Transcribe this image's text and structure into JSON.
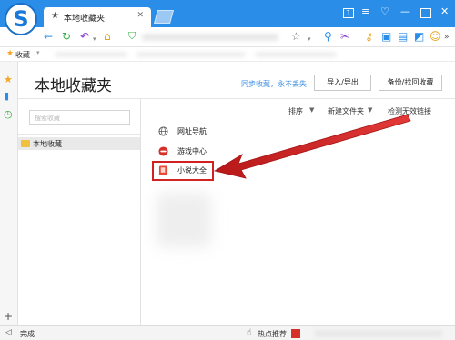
{
  "window": {
    "logo_letter": "S",
    "tab_title": "本地收藏夹",
    "tab_close": "✕",
    "controls": [
      "⊟",
      "≡",
      "♡",
      "—",
      "☐",
      "✕"
    ]
  },
  "toolbar": {
    "icons": [
      "back-icon",
      "refresh-icon",
      "undo-icon",
      "home-icon",
      "shield-icon",
      "star-icon",
      "scissors-icon",
      "key-icon",
      "tool-icons"
    ]
  },
  "bookmarks_bar": {
    "label": "收藏",
    "arrow": "▾"
  },
  "page": {
    "title": "本地收藏夹",
    "sync_link": "同步收藏，永不丢失",
    "import_export_button": "导入/导出",
    "backup_button": "备份/找回收藏",
    "search_placeholder": "搜索收藏",
    "folder_label": "本地收藏",
    "sort_label": "排序",
    "new_folder_label": "新建文件夹",
    "check_links_label": "检测无效链接",
    "dropdown_arrow": "▼",
    "items": [
      {
        "label": "网址导航",
        "icon": "globe-icon"
      },
      {
        "label": "游戏中心",
        "icon": "game-icon"
      },
      {
        "label": "小说大全",
        "icon": "book-icon"
      }
    ]
  },
  "statusbar": {
    "status_text": "完成",
    "hot_label": "热点推荐"
  },
  "colors": {
    "accent_blue": "#2a8de8",
    "highlight_red": "#d21f1f",
    "link_blue": "#3a8ee6"
  }
}
